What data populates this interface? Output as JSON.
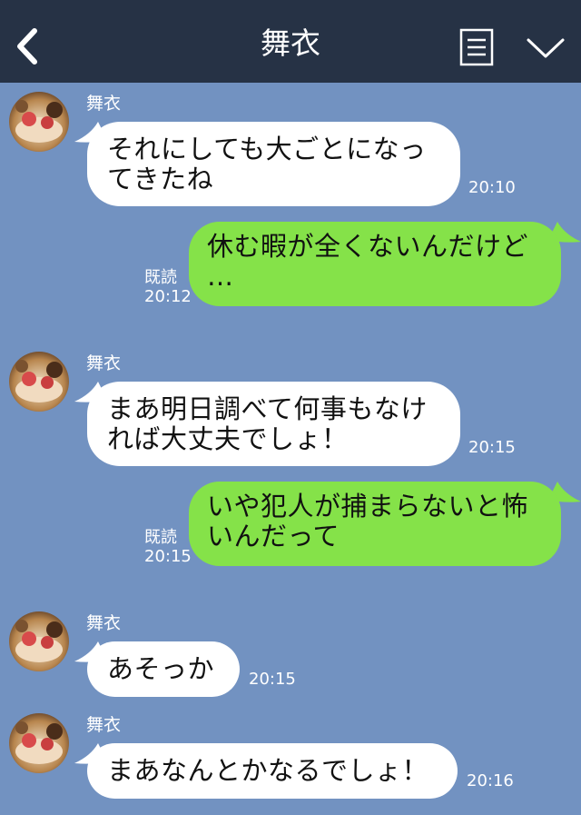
{
  "header": {
    "title": "舞衣",
    "background": "#263245",
    "icons": [
      "back-arrow-icon",
      "menu-list-icon",
      "chevron-down-icon"
    ]
  },
  "colors": {
    "chat_background": "#7292c1",
    "incoming_bubble": "#ffffff",
    "outgoing_bubble": "#85e249"
  },
  "messages": [
    {
      "direction": "in",
      "sender": "舞衣",
      "text": "それにしても大ごとになっ\nてきたね",
      "time": "20:10"
    },
    {
      "direction": "out",
      "text": "休む暇が全くないんだけど\n…",
      "read": "既読",
      "time": "20:12"
    },
    {
      "direction": "in",
      "sender": "舞衣",
      "text": "まあ明日調べて何事もなけ\nれば大丈夫でしょ！",
      "time": "20:15"
    },
    {
      "direction": "out",
      "text": "いや犯人が捕まらないと怖\nいんだって",
      "read": "既読",
      "time": "20:15"
    },
    {
      "direction": "in",
      "sender": "舞衣",
      "text": "あそっか",
      "time": "20:15"
    },
    {
      "direction": "in",
      "sender": "舞衣",
      "text": "まあなんとかなるでしょ！",
      "time": "20:16"
    }
  ]
}
